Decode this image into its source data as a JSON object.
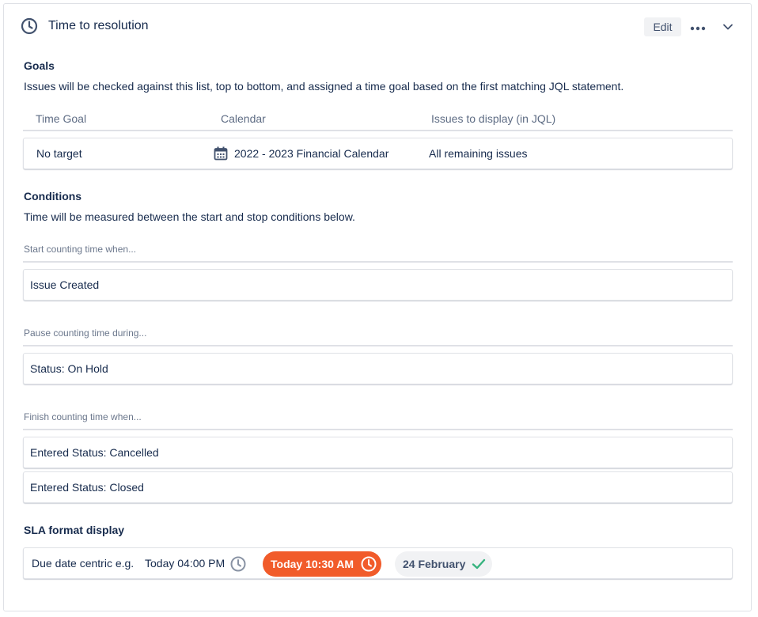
{
  "header": {
    "title": "Time to resolution",
    "edit_label": "Edit",
    "icons": {
      "title": "clock-icon",
      "more": "more-horizontal-icon",
      "collapse": "chevron-down-icon"
    }
  },
  "goals": {
    "title": "Goals",
    "description": "Issues will be checked against this list, top to bottom, and assigned a time goal based on the first matching JQL statement.",
    "columns": [
      "Time Goal",
      "Calendar",
      "Issues to display (in JQL)"
    ],
    "rows": [
      {
        "time_goal": "No target",
        "calendar": "2022 - 2023 Financial Calendar",
        "jql": "All remaining issues",
        "calendar_icon": "calendar-icon"
      }
    ]
  },
  "conditions": {
    "title": "Conditions",
    "description": "Time will be measured between the start and stop conditions below.",
    "start": {
      "label": "Start counting time when...",
      "items": [
        "Issue Created"
      ]
    },
    "pause": {
      "label": "Pause counting time during...",
      "items": [
        "Status: On Hold"
      ]
    },
    "finish": {
      "label": "Finish counting time when...",
      "items": [
        "Entered Status: Cancelled",
        "Entered Status: Closed"
      ]
    }
  },
  "sla_format": {
    "title": "SLA format display",
    "label": "Due date centric e.g.",
    "example_normal": "Today 04:00 PM",
    "example_breached": "Today 10:30 AM",
    "example_met": "24 February",
    "colors": {
      "breached": "#f15b2a",
      "met_check": "#36b37e",
      "normal_icon": "#8993a4"
    }
  }
}
